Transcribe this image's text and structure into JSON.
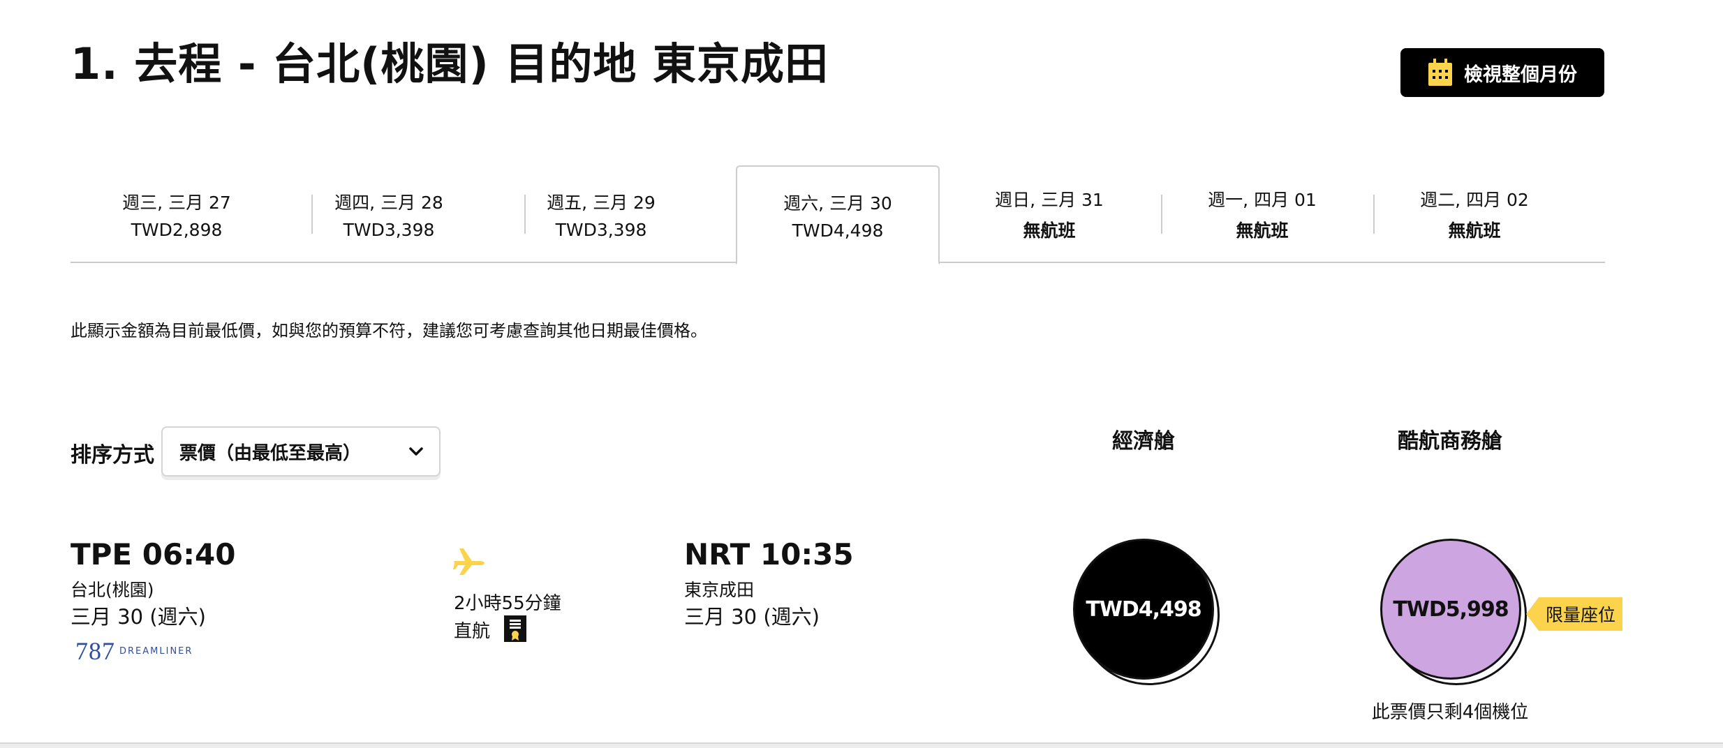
{
  "header": {
    "title": "1. 去程 - 台北(桃園) 目的地 東京成田",
    "month_button_label": "檢視整個月份"
  },
  "date_tabs": [
    {
      "date": "週三, 三月 27",
      "price": "TWD2,898",
      "no_flight": false,
      "active": false
    },
    {
      "date": "週四, 三月 28",
      "price": "TWD3,398",
      "no_flight": false,
      "active": false
    },
    {
      "date": "週五, 三月 29",
      "price": "TWD3,398",
      "no_flight": false,
      "active": false
    },
    {
      "date": "週六, 三月 30",
      "price": "TWD4,498",
      "no_flight": false,
      "active": true
    },
    {
      "date": "週日, 三月 31",
      "price": "無航班",
      "no_flight": true,
      "active": false
    },
    {
      "date": "週一, 四月 01",
      "price": "無航班",
      "no_flight": true,
      "active": false
    },
    {
      "date": "週二, 四月 02",
      "price": "無航班",
      "no_flight": true,
      "active": false
    }
  ],
  "notice": "此顯示金額為目前最低價，如與您的預算不符，建議您可考慮查詢其他日期最佳價格。",
  "sort": {
    "label": "排序方式",
    "selected": "票價（由最低至最高）"
  },
  "cabins": {
    "economy": "經濟艙",
    "business": "酷航商務艙"
  },
  "flight": {
    "departure": {
      "time": "TPE 06:40",
      "city": "台北(桃園)",
      "date": "三月 30 (週六)"
    },
    "aircraft": {
      "number": "787",
      "name": "DREAMLINER"
    },
    "duration": "2小時55分鐘",
    "stops": "直航",
    "arrival": {
      "time": "NRT 10:35",
      "city": "東京成田",
      "date": "三月 30 (週六)"
    },
    "fares": {
      "economy": {
        "price": "TWD4,498",
        "color": "#000000"
      },
      "business": {
        "price": "TWD5,998",
        "color": "#cda5e0",
        "tag": "限量座位",
        "seats_note": "此票價只剩4個機位"
      }
    }
  },
  "colors": {
    "accent_yellow": "#fcd34d",
    "business_purple": "#cda5e0",
    "aircraft_blue": "#2f4f9e"
  }
}
